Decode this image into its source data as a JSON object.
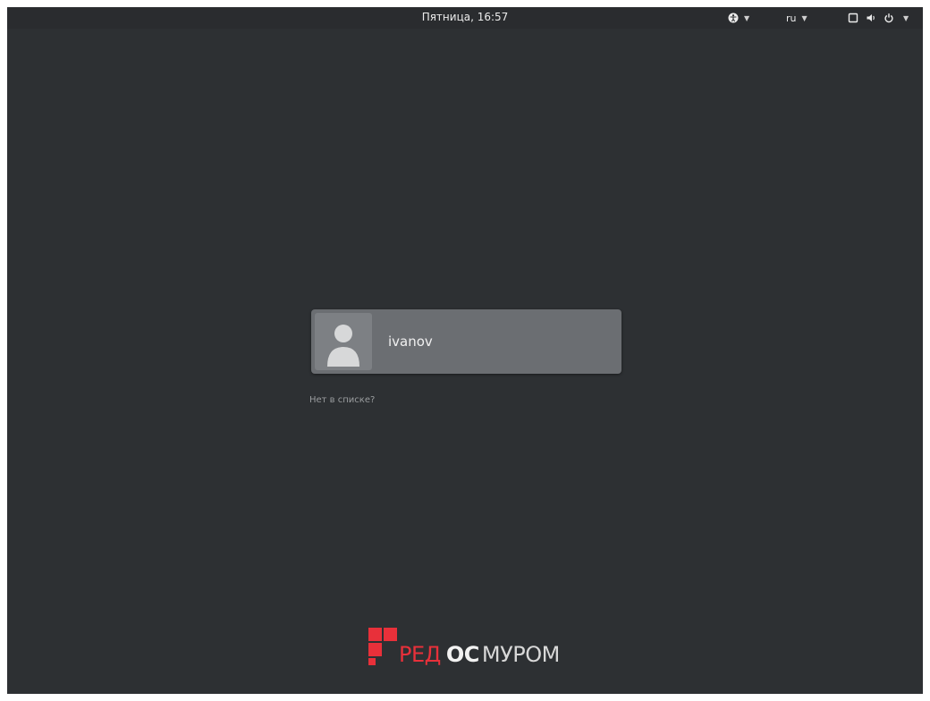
{
  "topbar": {
    "clock": "Пятница, 16:57",
    "accessibility_icon": "accessibility-icon",
    "keyboard_layout": "ru",
    "system_icons": [
      "display-icon",
      "volume-icon",
      "power-icon"
    ]
  },
  "login": {
    "username": "ivanov",
    "avatar_icon": "user-avatar-icon",
    "not_listed_link": "Нет в списке?"
  },
  "branding": {
    "logo_part1": "РЕД",
    "logo_part2": "ОС",
    "logo_part3": "МУРОМ",
    "colors": {
      "logo_red": "#e8303a",
      "background": "#2d3033"
    }
  }
}
